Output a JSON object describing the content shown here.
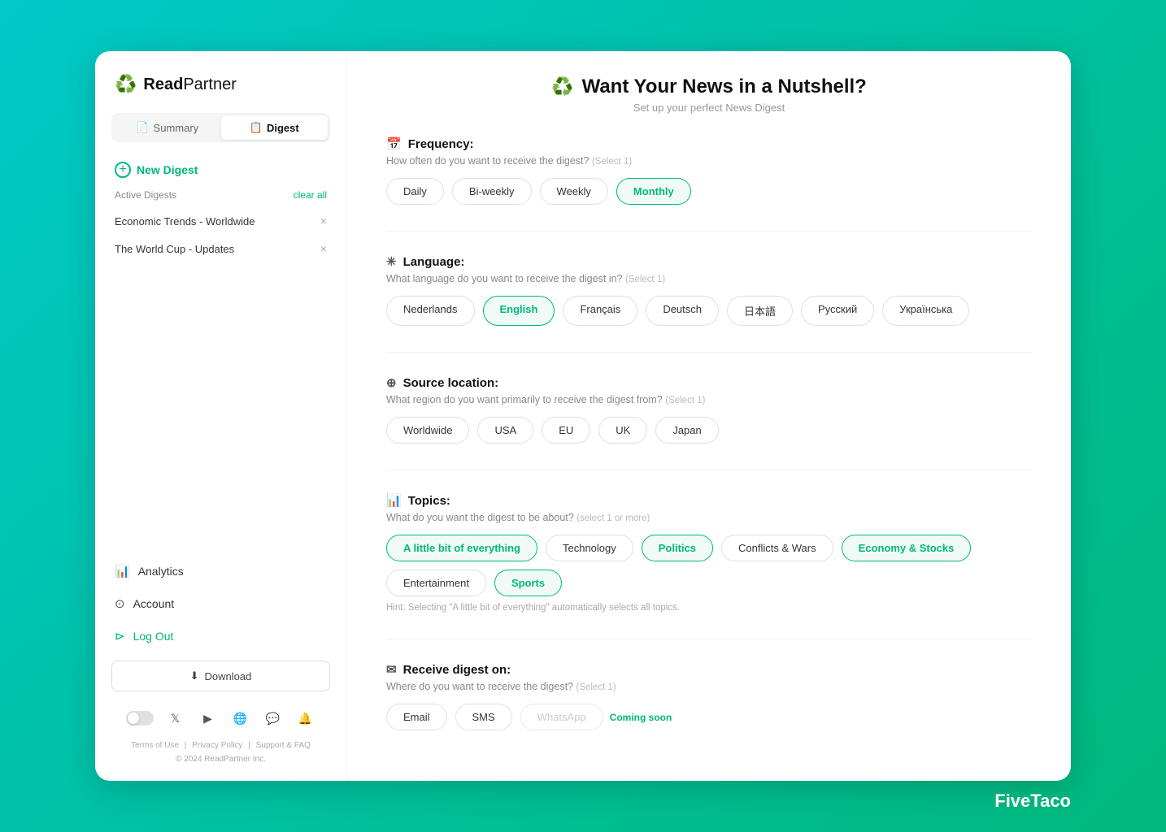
{
  "app": {
    "name": "ReadPartner",
    "tagline_bold": "Read",
    "tagline_light": "Partner"
  },
  "sidebar": {
    "tabs": [
      {
        "id": "summary",
        "label": "Summary",
        "icon": "📄",
        "active": false
      },
      {
        "id": "digest",
        "label": "Digest",
        "icon": "📋",
        "active": true
      }
    ],
    "new_digest_label": "New Digest",
    "active_digests_label": "Active Digests",
    "clear_all_label": "clear all",
    "digests": [
      {
        "id": "1",
        "label": "Economic Trends - Worldwide"
      },
      {
        "id": "2",
        "label": "The World Cup - Updates"
      }
    ],
    "nav_items": [
      {
        "id": "analytics",
        "label": "Analytics",
        "icon": "📊"
      },
      {
        "id": "account",
        "label": "Account",
        "icon": "👤"
      },
      {
        "id": "logout",
        "label": "Log Out",
        "icon": "🚪",
        "type": "logout"
      }
    ],
    "download_label": "Download",
    "social_icons": [
      "toggle",
      "𝕏",
      "▶",
      "🌐",
      "💬",
      "🔔"
    ],
    "footer": {
      "links": [
        "Terms of Use",
        "Privacy Policy",
        "Support & FAQ"
      ],
      "copyright": "© 2024 ReadPartner Inc."
    }
  },
  "main": {
    "header": {
      "title": "Want Your News in a Nutshell?",
      "subtitle": "Set up your perfect News Digest"
    },
    "sections": {
      "frequency": {
        "label": "Frequency:",
        "question": "How often do you want to receive the digest?",
        "hint": "Select 1",
        "options": [
          "Daily",
          "Bi-weekly",
          "Weekly",
          "Monthly"
        ],
        "selected": "Monthly"
      },
      "language": {
        "label": "Language:",
        "question": "What language do you want to receive the digest in?",
        "hint": "Select 1",
        "options": [
          "Nederlands",
          "English",
          "Français",
          "Deutsch",
          "日本語",
          "Русский",
          "Українська"
        ],
        "selected": "English"
      },
      "source_location": {
        "label": "Source location:",
        "question": "What region do you want primarily to receive the digest from?",
        "hint": "Select 1",
        "options": [
          "Worldwide",
          "USA",
          "EU",
          "UK",
          "Japan"
        ],
        "selected": null
      },
      "topics": {
        "label": "Topics:",
        "question": "What do you want the digest to be about?",
        "hint": "select 1 or more",
        "options": [
          "A little bit of everything",
          "Technology",
          "Politics",
          "Conflicts & Wars",
          "Economy & Stocks",
          "Entertainment",
          "Sports"
        ],
        "selected": [
          "A little bit of everything",
          "Politics",
          "Economy & Stocks",
          "Sports"
        ],
        "hint_text": "Hint: Selecting \"A little bit of everything\" automatically selects all topics."
      },
      "receive": {
        "label": "Receive digest on:",
        "question": "Where do you want to receive the digest?",
        "hint": "Select 1",
        "options": [
          "Email",
          "SMS",
          "WhatsApp"
        ],
        "coming_soon_label": "Coming soon",
        "selected": null
      }
    }
  },
  "branding": {
    "fivetaco": "FiveTaco"
  }
}
